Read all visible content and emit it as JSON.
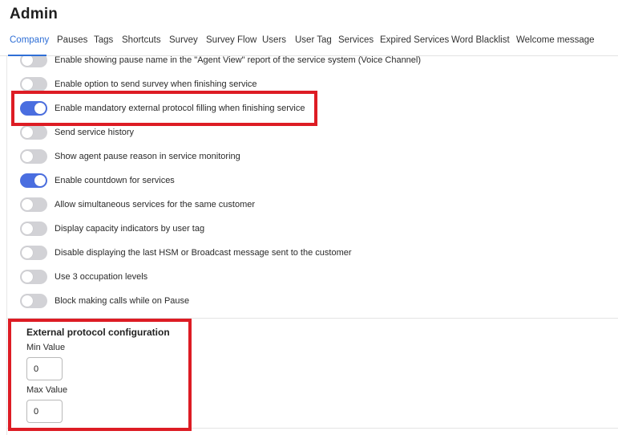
{
  "page": {
    "title": "Admin"
  },
  "tabs": [
    {
      "label": "Company",
      "active": true
    },
    {
      "label": "Pauses",
      "active": false
    },
    {
      "label": "Tags",
      "active": false
    },
    {
      "label": "Shortcuts",
      "active": false
    },
    {
      "label": "Survey",
      "active": false
    },
    {
      "label": "Survey Flow",
      "active": false
    },
    {
      "label": "Users",
      "active": false
    },
    {
      "label": "User Tag",
      "active": false
    },
    {
      "label": "Services",
      "active": false
    },
    {
      "label": "Expired Services",
      "active": false
    },
    {
      "label": "Word Blacklist",
      "active": false
    },
    {
      "label": "Welcome message",
      "active": false
    }
  ],
  "settings": [
    {
      "label": "Enable showing pause name in the \"Agent View\" report of the service system (Voice Channel)",
      "enabled": false
    },
    {
      "label": "Enable option to send survey when finishing service",
      "enabled": false
    },
    {
      "label": "Enable mandatory external protocol filling when finishing service",
      "enabled": true,
      "highlighted": true
    },
    {
      "label": "Send service history",
      "enabled": false
    },
    {
      "label": "Show agent pause reason in service monitoring",
      "enabled": false
    },
    {
      "label": "Enable countdown for services",
      "enabled": true
    },
    {
      "label": "Allow simultaneous services for the same customer",
      "enabled": false
    },
    {
      "label": "Display capacity indicators by user tag",
      "enabled": false
    },
    {
      "label": "Disable displaying the last HSM or Broadcast message sent to the customer",
      "enabled": false
    },
    {
      "label": "Use 3 occupation levels",
      "enabled": false
    },
    {
      "label": "Block making calls while on Pause",
      "enabled": false
    }
  ],
  "external_protocol": {
    "title": "External protocol configuration",
    "min_label": "Min Value",
    "min_value": "0",
    "max_label": "Max Value",
    "max_value": "0"
  },
  "colors": {
    "accent": "#2f6fd6",
    "toggle_on": "#4a6ee0",
    "toggle_off": "#d2d2d6",
    "highlight": "#dd1c24"
  }
}
